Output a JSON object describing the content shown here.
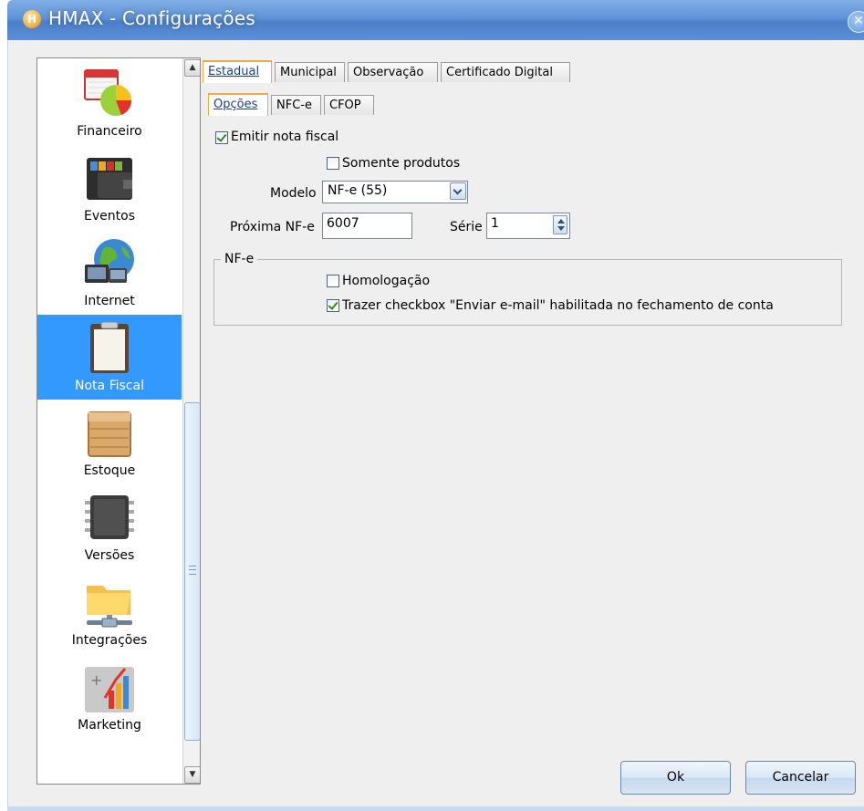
{
  "window": {
    "title": "HMAX - Configurações",
    "logo_letter": "H",
    "close_glyph": "✕"
  },
  "sidebar": {
    "items": [
      {
        "label": "Financeiro",
        "icon": "finance-chart-icon"
      },
      {
        "label": "Eventos",
        "icon": "wallet-icon"
      },
      {
        "label": "Internet",
        "icon": "globe-network-icon"
      },
      {
        "label": "Nota Fiscal",
        "icon": "clipboard-icon",
        "active": true
      },
      {
        "label": "Estoque",
        "icon": "crate-icon"
      },
      {
        "label": "Versões",
        "icon": "chip-icon"
      },
      {
        "label": "Integrações",
        "icon": "network-folder-icon"
      },
      {
        "label": "Marketing",
        "icon": "marketing-chart-icon"
      }
    ],
    "scroll_up": "▲",
    "scroll_down": "▼"
  },
  "tabs": {
    "main": [
      "Estadual",
      "Municipal",
      "Observação",
      "Certificado Digital"
    ],
    "sub": [
      "Opções",
      "NFC-e",
      "CFOP"
    ]
  },
  "form": {
    "emitir_label": "Emitir nota fiscal",
    "emitir_checked": true,
    "somente_label": "Somente produtos",
    "somente_checked": false,
    "modelo_label": "Modelo",
    "modelo_value": "NF-e (55)",
    "proxima_label": "Próxima NF-e",
    "proxima_value": "6007",
    "serie_label": "Série",
    "serie_value": "1"
  },
  "nfe_group": {
    "title": "NF-e",
    "homologacao_label": "Homologação",
    "homologacao_checked": false,
    "trazer_label": "Trazer checkbox \"Enviar e-mail\" habilitada no fechamento de conta",
    "trazer_checked": true
  },
  "buttons": {
    "ok": "Ok",
    "cancel": "Cancelar"
  },
  "colors": {
    "titlebar": "#5f93d7",
    "selection": "#3399ff",
    "active_tab_border": "#f0a84a"
  }
}
